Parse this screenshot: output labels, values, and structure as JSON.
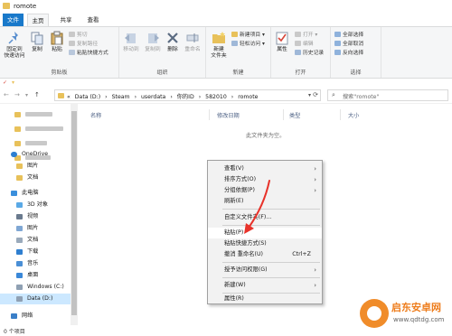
{
  "window": {
    "title": "romote"
  },
  "ribbon_tabs": [
    "文件",
    "主页",
    "共享",
    "查看"
  ],
  "ribbon": {
    "clipboard": {
      "pin_label_line1": "固定到",
      "pin_label_line2": "快速访问",
      "copy_label": "复制",
      "paste_label": "粘贴",
      "cut_label": "剪切",
      "copy_path_label": "复制路径",
      "paste_shortcut_label": "粘贴快捷方式",
      "group_label": "剪贴板"
    },
    "organize": {
      "move_to_label": "移动到",
      "copy_to_label": "复制到",
      "delete_label": "删除",
      "rename_label": "重命名",
      "group_label": "组织"
    },
    "new": {
      "new_folder_line1": "新建",
      "new_folder_line2": "文件夹",
      "new_item_label": "新建项目 ▾",
      "easy_access_label": "轻松访问 ▾",
      "group_label": "新建"
    },
    "open": {
      "properties_label": "属性",
      "open_label": "打开 ▾",
      "edit_label": "编辑",
      "history_label": "历史记录",
      "group_label": "打开"
    },
    "select": {
      "select_all_label": "全部选择",
      "select_none_label": "全部取消",
      "invert_label": "反向选择",
      "group_label": "选择"
    }
  },
  "quick_access_toolbar": {
    "items": [
      "✓",
      "▾"
    ]
  },
  "navigation": {
    "back": "←",
    "forward": "→",
    "recent": "▾",
    "up": "↑",
    "breadcrumbs": [
      "«",
      "Data (D:)",
      "›",
      "Steam",
      "›",
      "userdata",
      "›",
      "你的ID",
      "›",
      "582010",
      "›",
      "romote"
    ],
    "dropdown": "▾",
    "refresh": "⟳",
    "search_placeholder": "搜索\"romote\""
  },
  "sidebar": {
    "items": [
      {
        "label": "",
        "icon": "folder-icon"
      },
      {
        "label": "",
        "icon": "folder-icon"
      },
      {
        "label": "",
        "icon": "folder-icon"
      },
      {
        "label": "",
        "icon": "folder-icon"
      },
      {
        "label": "OneDrive",
        "icon": "cloud-icon"
      },
      {
        "label": "图片",
        "icon": "folder-icon"
      },
      {
        "label": "文档",
        "icon": "folder-icon"
      },
      {
        "label": "此电脑",
        "icon": "computer-icon"
      },
      {
        "label": "3D 对象",
        "icon": "cube-icon"
      },
      {
        "label": "视频",
        "icon": "video-icon"
      },
      {
        "label": "图片",
        "icon": "pictures-icon"
      },
      {
        "label": "文档",
        "icon": "document-icon"
      },
      {
        "label": "下载",
        "icon": "download-icon"
      },
      {
        "label": "音乐",
        "icon": "music-icon"
      },
      {
        "label": "桌面",
        "icon": "desktop-icon"
      },
      {
        "label": "Windows (C:)",
        "icon": "drive-icon"
      },
      {
        "label": "Data (D:)",
        "icon": "drive-icon"
      },
      {
        "label": "网络",
        "icon": "network-icon"
      }
    ]
  },
  "file_list": {
    "columns": [
      "名称",
      "修改日期",
      "类型",
      "大小"
    ],
    "empty_text": "此文件夹为空。"
  },
  "status_bar": {
    "text": "0 个项目"
  },
  "context_menu": {
    "items": [
      {
        "label": "查看(V)",
        "submenu": true
      },
      {
        "label": "排序方式(O)",
        "submenu": true
      },
      {
        "label": "分组依据(P)",
        "submenu": true
      },
      {
        "label": "刷新(E)"
      },
      {
        "label": "自定义文件夹(F)..."
      },
      {
        "label": "粘贴(P)"
      },
      {
        "label": "粘贴快捷方式(S)"
      },
      {
        "label": "撤消 重命名(U)",
        "shortcut": "Ctrl+Z"
      },
      {
        "label": "授予访问权限(G)",
        "submenu": true
      },
      {
        "label": "新建(W)",
        "submenu": true
      },
      {
        "label": "属性(R)"
      }
    ],
    "submenu_arrow": "›"
  },
  "watermark": {
    "title": "启东安卓网",
    "url": "www.qdtdg.com"
  },
  "colors": {
    "accent": "#1979ca",
    "folder": "#e8c15a",
    "selection": "#cce8ff",
    "annotation_arrow": "#e8322a",
    "watermark": "#ee7d1c"
  }
}
